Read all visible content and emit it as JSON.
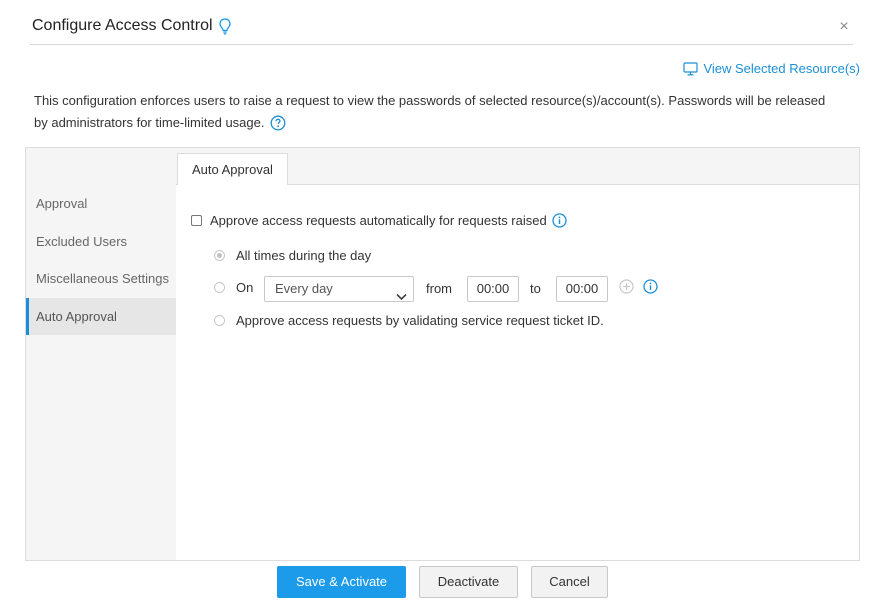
{
  "dialog": {
    "title": "Configure Access Control",
    "close_glyph": "×",
    "title_icon": "lightbulb-icon",
    "close_icon": "close-icon"
  },
  "view_link": {
    "label": "View Selected Resource(s)",
    "icon": "monitor-icon"
  },
  "description": {
    "text": "This configuration enforces users to raise a request to view the passwords of selected resource(s)/account(s). Passwords will be released by administrators for time-limited usage.",
    "icon": "help-circle-icon"
  },
  "sidebar": {
    "items": [
      {
        "label": "Approval",
        "active": false
      },
      {
        "label": "Excluded Users",
        "active": false
      },
      {
        "label": "Miscellaneous Settings",
        "active": false
      },
      {
        "label": "Auto Approval",
        "active": true
      }
    ]
  },
  "tab": {
    "label": "Auto Approval"
  },
  "auto_approval": {
    "checkbox_label": "Approve access requests automatically for requests raised",
    "checkbox_checked": false,
    "options": {
      "all_times": {
        "label": "All times during the day",
        "checked": true
      },
      "on": {
        "label": "On",
        "checked": false
      },
      "ticket": {
        "label": "Approve access requests by validating service request ticket ID.",
        "checked": false
      }
    },
    "schedule": {
      "day_select_value": "Every day",
      "from_label": "from",
      "from_value": "00:00",
      "to_label": "to",
      "to_value": "00:00"
    }
  },
  "buttons": {
    "save_label": "Save & Activate",
    "deactivate_label": "Deactivate",
    "cancel_label": "Cancel"
  },
  "colors": {
    "accent": "#1b8fd6",
    "primary_button": "#1b9bea",
    "panel_bg": "#f5f5f5",
    "active_sidebar_bg": "#e6e6e6"
  }
}
